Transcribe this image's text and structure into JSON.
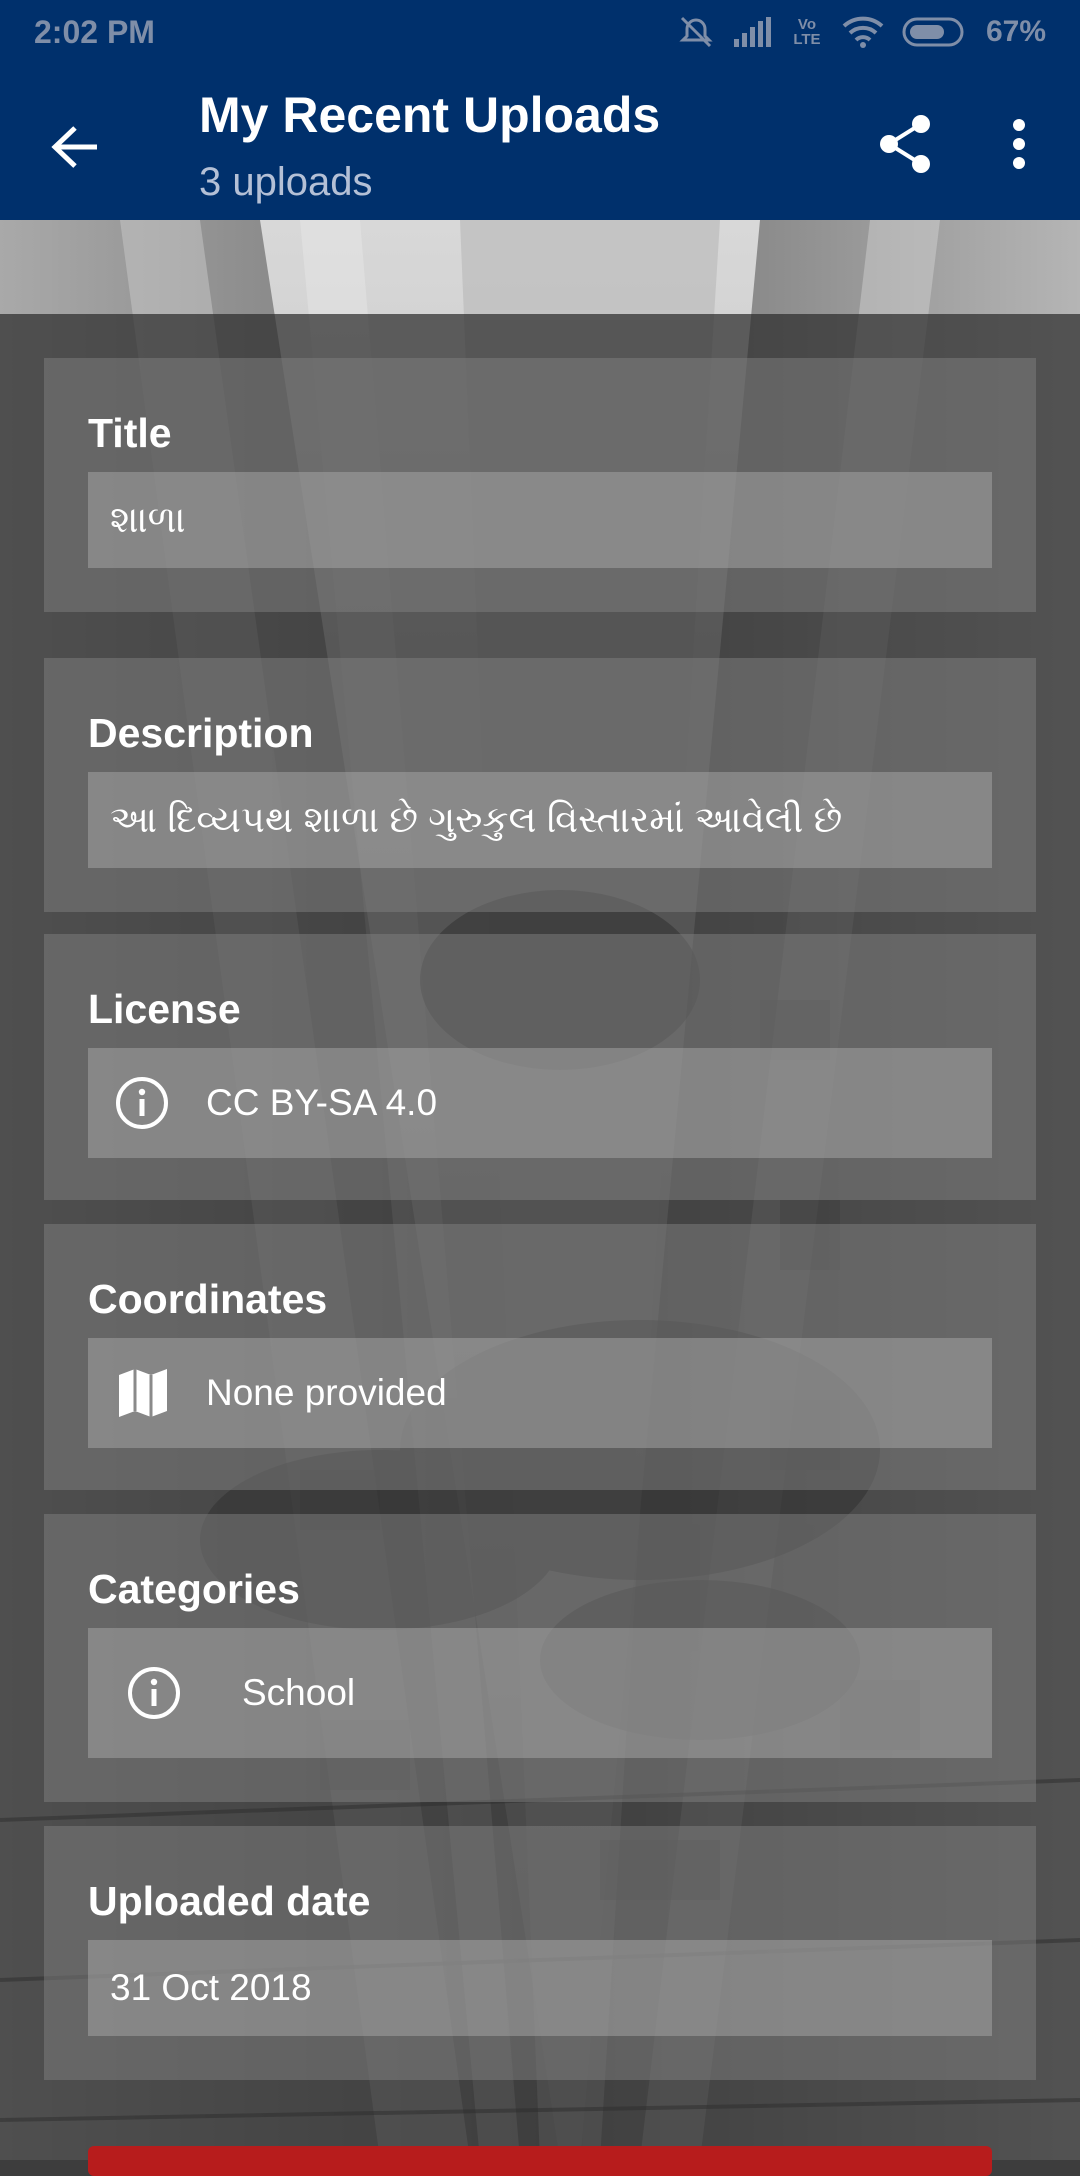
{
  "status_bar": {
    "time": "2:02 PM",
    "network_label": "Vo LTE",
    "battery_percent": "67%"
  },
  "app_bar": {
    "title": "My Recent Uploads",
    "subtitle": "3 uploads",
    "background_color": "#00306c"
  },
  "details": {
    "title": {
      "label": "Title",
      "value": "શાળા"
    },
    "description": {
      "label": "Description",
      "value": "આ દિવ્યપથ શાળા છે ગુરુકુલ વિસ્તારમાં આવેલી છે"
    },
    "license": {
      "label": "License",
      "value": "CC BY-SA 4.0",
      "icon": "info-icon"
    },
    "coordinates": {
      "label": "Coordinates",
      "value": "None provided",
      "icon": "map-icon"
    },
    "categories": {
      "label": "Categories",
      "items": [
        "School"
      ],
      "icon": "info-icon"
    },
    "uploaded_date": {
      "label": "Uploaded date",
      "value": "31 Oct 2018"
    }
  },
  "colors": {
    "card_background": "rgba(128,128,128,0.5)",
    "field_background": "rgba(175,175,175,0.45)",
    "delete_button": "#b71c1c"
  }
}
